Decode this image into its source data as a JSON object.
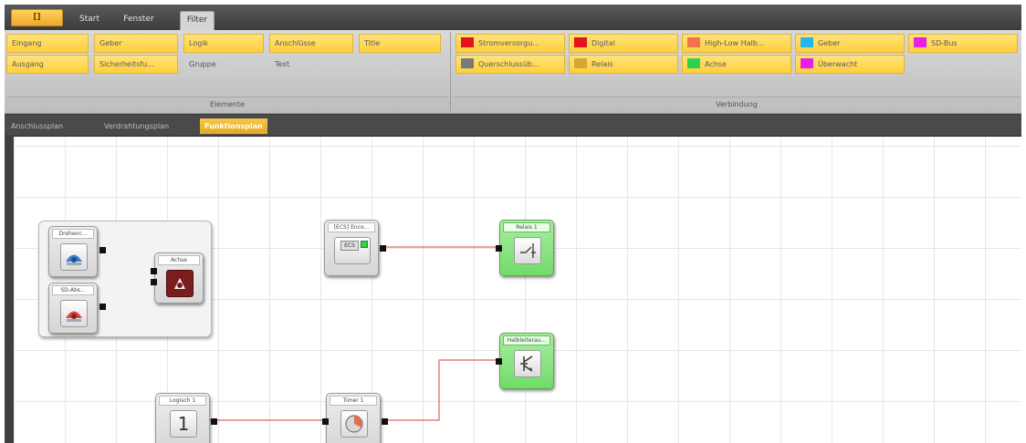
{
  "menu": {
    "app_button": "[]",
    "tabs": [
      "Start",
      "Fenster",
      "Filter"
    ],
    "active_tab": "Filter"
  },
  "ribbon": {
    "elements": {
      "row1": [
        "Eingang",
        "Geber",
        "Logik",
        "Anschlüsse",
        "Title"
      ],
      "row2": [
        "Ausgang",
        "Sicherheitsfu...",
        "Gruppe",
        "Text"
      ],
      "label": "Elemente"
    },
    "connections": {
      "row1": [
        {
          "label": "Stromversorgu...",
          "color": "#e3121b"
        },
        {
          "label": "Digital",
          "color": "#e3121b"
        },
        {
          "label": "High-Low Halb...",
          "color": "#f0744a"
        },
        {
          "label": "Geber",
          "color": "#22b7ea"
        },
        {
          "label": "SD-Bus",
          "color": "#e61ee6"
        }
      ],
      "row2": [
        {
          "label": "Querschlussüb...",
          "color": "#7a7a7a"
        },
        {
          "label": "Relais",
          "color": "#d9a62e"
        },
        {
          "label": "Achse",
          "color": "#2ed24a"
        },
        {
          "label": "Überwacht",
          "color": "#e61ee6"
        }
      ],
      "label": "Verbindung"
    }
  },
  "doc_tabs": [
    "Anschlussplan",
    "Verdrahtungsplan",
    "Funktionsplan"
  ],
  "active_doc_tab": "Funktionsplan",
  "blocks": {
    "geber": "Drehenc...",
    "sd_abs": "SD-Abs...",
    "achse": "Achse",
    "eco": "[ECS] Enco...",
    "eco_icon": "ECS",
    "relais": "Relais 1",
    "halbleiter": "Halbleiterau...",
    "logisch": "Logisch 1",
    "logisch_value": "1",
    "timer": "Timer 1"
  },
  "colors": {
    "wire_red": "#e06060",
    "wire_cyan": "#31c0e0",
    "block_green": "#7fe077",
    "accent_orange": "#f5b52e"
  }
}
